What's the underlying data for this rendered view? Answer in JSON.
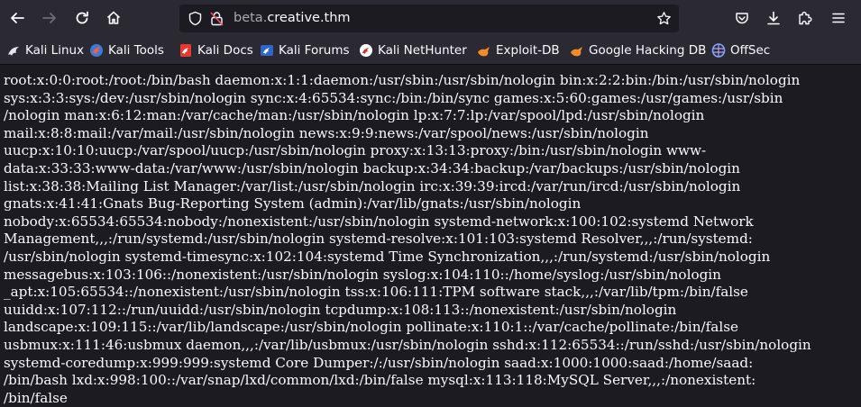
{
  "browser": {
    "url_prefix": "beta.",
    "url_host": "creative.thm"
  },
  "bookmarks": [
    {
      "label": "Kali Linux",
      "icon": "kali-dragon-icon"
    },
    {
      "label": "Kali Tools",
      "icon": "kali-tools-icon"
    },
    {
      "label": "Kali Docs",
      "icon": "kali-docs-icon"
    },
    {
      "label": "Kali Forums",
      "icon": "kali-forums-icon"
    },
    {
      "label": "Kali NetHunter",
      "icon": "kali-nethunter-icon"
    },
    {
      "label": "Exploit-DB",
      "icon": "exploit-db-icon"
    },
    {
      "label": "Google Hacking DB",
      "icon": "ghdb-icon"
    },
    {
      "label": "OffSec",
      "icon": "offsec-icon"
    }
  ],
  "page": {
    "lines": [
      "root:x:0:0:root:/root:/bin/bash daemon:x:1:1:daemon:/usr/sbin:/usr/sbin/nologin bin:x:2:2:bin:/bin:/usr/sbin/nologin",
      "sys:x:3:3:sys:/dev:/usr/sbin/nologin sync:x:4:65534:sync:/bin:/bin/sync games:x:5:60:games:/usr/games:/usr/sbin",
      "/nologin man:x:6:12:man:/var/cache/man:/usr/sbin/nologin lp:x:7:7:lp:/var/spool/lpd:/usr/sbin/nologin",
      "mail:x:8:8:mail:/var/mail:/usr/sbin/nologin news:x:9:9:news:/var/spool/news:/usr/sbin/nologin",
      "uucp:x:10:10:uucp:/var/spool/uucp:/usr/sbin/nologin proxy:x:13:13:proxy:/bin:/usr/sbin/nologin www-",
      "data:x:33:33:www-data:/var/www:/usr/sbin/nologin backup:x:34:34:backup:/var/backups:/usr/sbin/nologin",
      "list:x:38:38:Mailing List Manager:/var/list:/usr/sbin/nologin irc:x:39:39:ircd:/var/run/ircd:/usr/sbin/nologin",
      "gnats:x:41:41:Gnats Bug-Reporting System (admin):/var/lib/gnats:/usr/sbin/nologin",
      "nobody:x:65534:65534:nobody:/nonexistent:/usr/sbin/nologin systemd-network:x:100:102:systemd Network",
      "Management,,,:/run/systemd:/usr/sbin/nologin systemd-resolve:x:101:103:systemd Resolver,,,:/run/systemd:",
      "/usr/sbin/nologin systemd-timesync:x:102:104:systemd Time Synchronization,,,:/run/systemd:/usr/sbin/nologin",
      "messagebus:x:103:106::/nonexistent:/usr/sbin/nologin syslog:x:104:110::/home/syslog:/usr/sbin/nologin",
      "_apt:x:105:65534::/nonexistent:/usr/sbin/nologin tss:x:106:111:TPM software stack,,,:/var/lib/tpm:/bin/false",
      "uuidd:x:107:112::/run/uuidd:/usr/sbin/nologin tcpdump:x:108:113::/nonexistent:/usr/sbin/nologin",
      "landscape:x:109:115::/var/lib/landscape:/usr/sbin/nologin pollinate:x:110:1::/var/cache/pollinate:/bin/false",
      "usbmux:x:111:46:usbmux daemon,,,:/var/lib/usbmux:/usr/sbin/nologin sshd:x:112:65534::/run/sshd:/usr/sbin/nologin",
      "systemd-coredump:x:999:999:systemd Core Dumper:/:/usr/sbin/nologin saad:x:1000:1000:saad:/home/saad:",
      "/bin/bash lxd:x:998:100::/var/snap/lxd/common/lxd:/bin/false mysql:x:113:118:MySQL Server,,,:/nonexistent:",
      "/bin/false"
    ]
  }
}
